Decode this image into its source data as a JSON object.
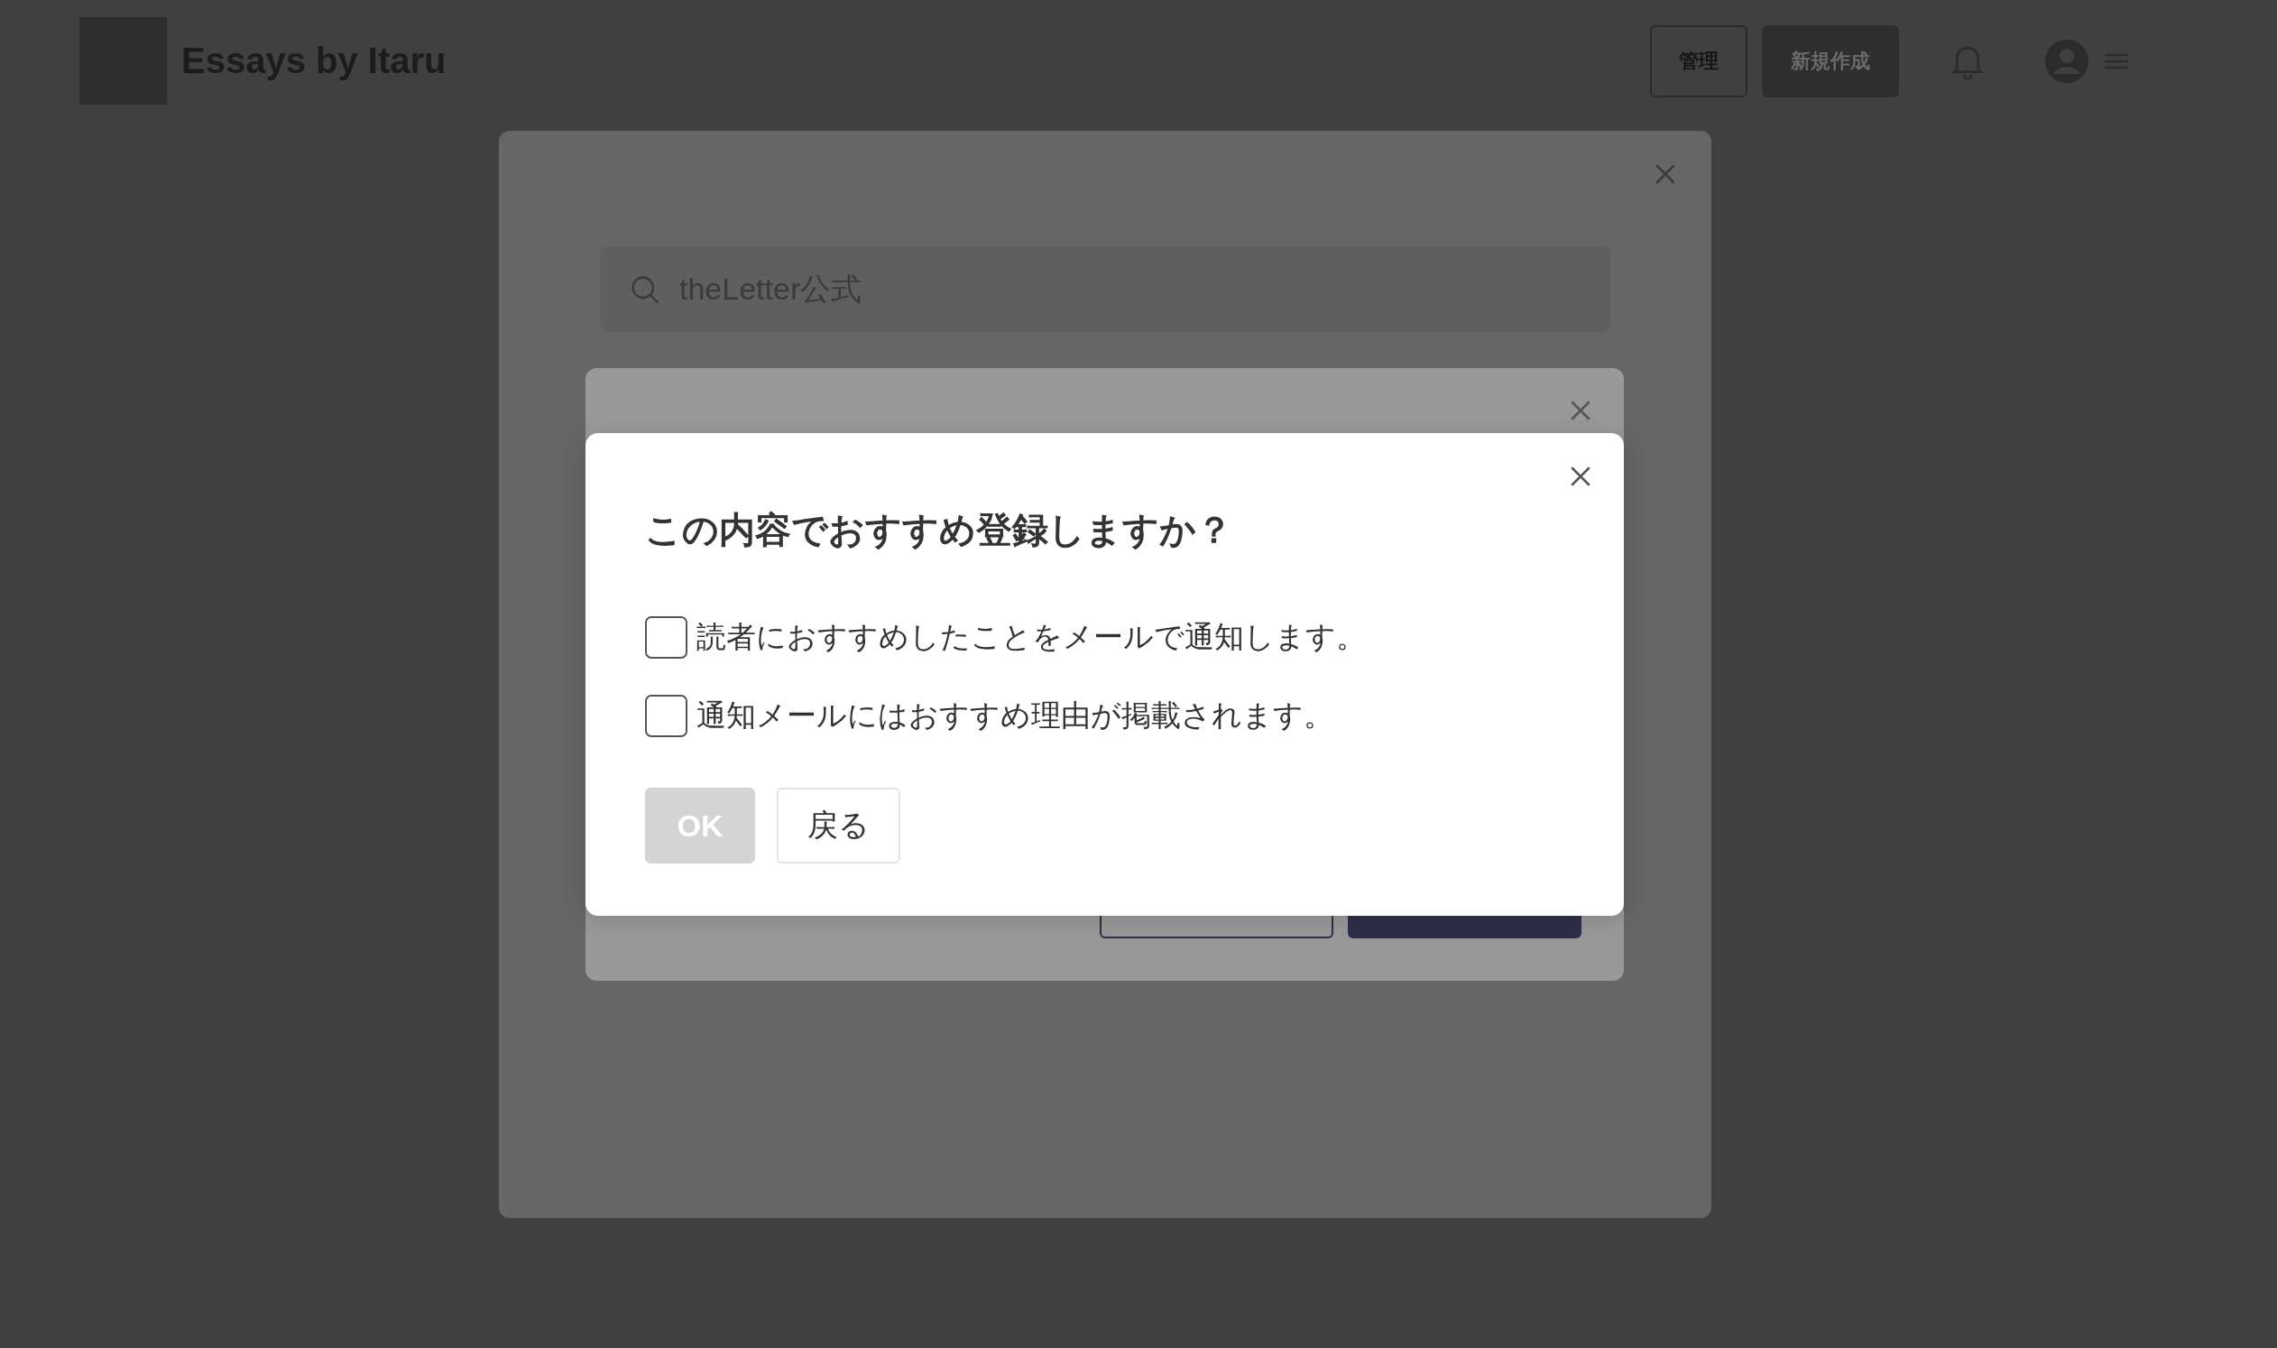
{
  "header": {
    "title": "Essays by Itaru",
    "buttons": [
      {
        "label": "管理",
        "kind": "outline"
      },
      {
        "label": "新規作成",
        "kind": "filled"
      }
    ]
  },
  "search": {
    "value": "theLetter公式"
  },
  "dialog": {
    "title": "この内容でおすすめ登録しますか？",
    "options": [
      {
        "label": "読者におすすめしたことをメールで通知します。",
        "checked": false
      },
      {
        "label": "通知メールにはおすすめ理由が掲載されます。",
        "checked": false
      }
    ],
    "buttons": [
      {
        "label": "OK",
        "disabled": true
      },
      {
        "label": "戻る",
        "disabled": false
      }
    ]
  }
}
